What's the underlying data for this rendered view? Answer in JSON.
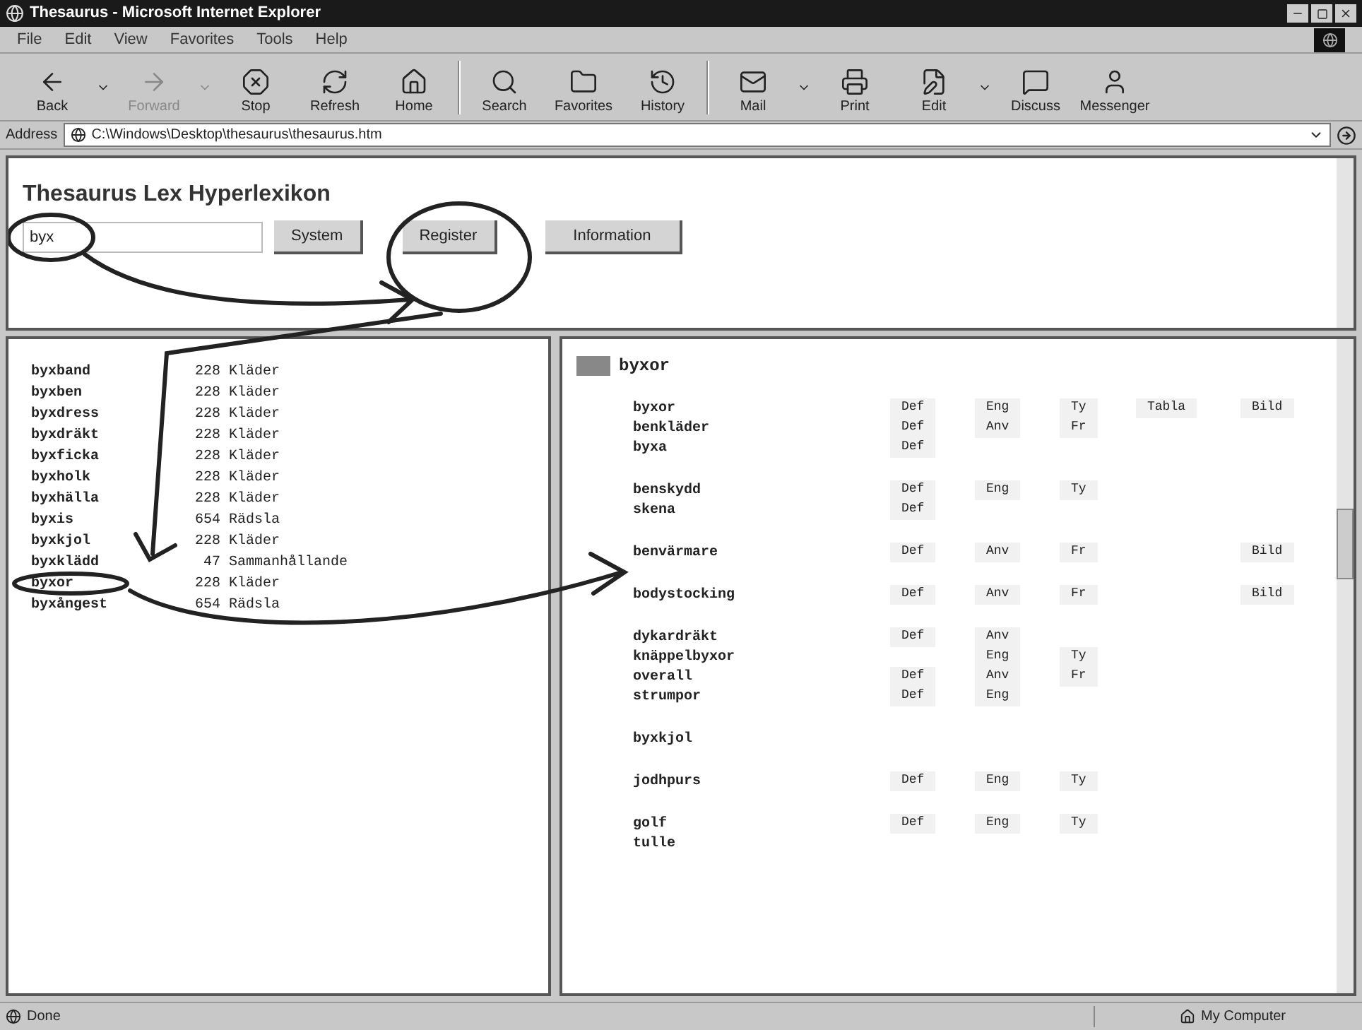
{
  "window": {
    "title": "Thesaurus - Microsoft Internet Explorer"
  },
  "menu": [
    "File",
    "Edit",
    "View",
    "Favorites",
    "Tools",
    "Help"
  ],
  "toolbar": [
    {
      "label": "Back",
      "dropdown": true,
      "disabled": false
    },
    {
      "label": "Forward",
      "dropdown": true,
      "disabled": true
    },
    {
      "label": "Stop",
      "dropdown": false,
      "disabled": false
    },
    {
      "label": "Refresh",
      "dropdown": false,
      "disabled": false
    },
    {
      "label": "Home",
      "dropdown": false,
      "disabled": false
    },
    {
      "label": "Search",
      "dropdown": false,
      "disabled": false
    },
    {
      "label": "Favorites",
      "dropdown": false,
      "disabled": false
    },
    {
      "label": "History",
      "dropdown": false,
      "disabled": false
    },
    {
      "label": "Mail",
      "dropdown": true,
      "disabled": false
    },
    {
      "label": "Print",
      "dropdown": false,
      "disabled": false
    },
    {
      "label": "Edit",
      "dropdown": true,
      "disabled": false
    },
    {
      "label": "Discuss",
      "dropdown": false,
      "disabled": false
    },
    {
      "label": "Messenger",
      "dropdown": false,
      "disabled": false
    }
  ],
  "address": {
    "label": "Address",
    "value": "C:\\Windows\\Desktop\\thesaurus\\thesaurus.htm"
  },
  "page": {
    "title": "Thesaurus Lex Hyperlexikon",
    "search": {
      "value": "byx"
    },
    "buttons": [
      "System",
      "Register",
      "Information"
    ]
  },
  "list": [
    {
      "word": "byxband",
      "number": "228",
      "category": "Kläder"
    },
    {
      "word": "byxben",
      "number": "228",
      "category": "Kläder"
    },
    {
      "word": "byxdress",
      "number": "228",
      "category": "Kläder"
    },
    {
      "word": "byxdräkt",
      "number": "228",
      "category": "Kläder"
    },
    {
      "word": "byxficka",
      "number": "228",
      "category": "Kläder"
    },
    {
      "word": "byxholk",
      "number": "228",
      "category": "Kläder"
    },
    {
      "word": "byxhälla",
      "number": "228",
      "category": "Kläder"
    },
    {
      "word": "byxis",
      "number": "654",
      "category": "Rädsla"
    },
    {
      "word": "byxkjol",
      "number": "228",
      "category": "Kläder"
    },
    {
      "word": "byxklädd",
      "number": "47",
      "category": "Sammanhållande"
    },
    {
      "word": "byxor",
      "number": "228",
      "category": "Kläder"
    },
    {
      "word": "byxångest",
      "number": "654",
      "category": "Rädsla"
    }
  ],
  "entry": {
    "heading": "byxor",
    "groups": [
      [
        {
          "word": "byxor",
          "links": [
            {
              "kind": "def",
              "text": "Def"
            },
            {
              "kind": "eng",
              "text": "Eng"
            },
            {
              "kind": "ty",
              "text": "Ty"
            },
            {
              "kind": "tabla",
              "text": "Tabla"
            },
            {
              "kind": "bild",
              "text": "Bild"
            }
          ]
        },
        {
          "word": "benkläder",
          "links": [
            {
              "kind": "def",
              "text": "Def"
            },
            {
              "kind": "eng",
              "text": "Anv"
            },
            {
              "kind": "ty",
              "text": "Fr"
            }
          ]
        },
        {
          "word": "byxa",
          "links": [
            {
              "kind": "def",
              "text": "Def"
            }
          ]
        }
      ],
      [
        {
          "word": "benskydd",
          "links": [
            {
              "kind": "def",
              "text": "Def"
            },
            {
              "kind": "eng",
              "text": "Eng"
            },
            {
              "kind": "ty",
              "text": "Ty"
            }
          ]
        },
        {
          "word": "skena",
          "links": [
            {
              "kind": "def",
              "text": "Def"
            }
          ]
        }
      ],
      [
        {
          "word": "benvärmare",
          "links": [
            {
              "kind": "def",
              "text": "Def"
            },
            {
              "kind": "eng",
              "text": "Anv"
            },
            {
              "kind": "ty",
              "text": "Fr"
            },
            {
              "kind": "bild",
              "text": "Bild"
            }
          ]
        }
      ],
      [
        {
          "word": "bodystocking",
          "links": [
            {
              "kind": "def",
              "text": "Def"
            },
            {
              "kind": "eng",
              "text": "Anv"
            },
            {
              "kind": "ty",
              "text": "Fr"
            },
            {
              "kind": "bild",
              "text": "Bild"
            }
          ]
        }
      ],
      [
        {
          "word": "dykardräkt",
          "links": [
            {
              "kind": "def",
              "text": "Def"
            },
            {
              "kind": "eng",
              "text": "Anv"
            }
          ]
        },
        {
          "word": "knäppelbyxor",
          "links": [
            {
              "kind": "eng",
              "text": "Eng"
            },
            {
              "kind": "ty",
              "text": "Ty"
            }
          ]
        },
        {
          "word": "overall",
          "links": [
            {
              "kind": "def",
              "text": "Def"
            },
            {
              "kind": "eng",
              "text": "Anv"
            },
            {
              "kind": "ty",
              "text": "Fr"
            }
          ]
        },
        {
          "word": "strumpor",
          "links": [
            {
              "kind": "def",
              "text": "Def"
            },
            {
              "kind": "eng",
              "text": "Eng"
            }
          ]
        }
      ],
      [
        {
          "word": "byxkjol"
        }
      ],
      [
        {
          "word": "jodhpurs",
          "links": [
            {
              "kind": "def",
              "text": "Def"
            },
            {
              "kind": "eng",
              "text": "Eng"
            },
            {
              "kind": "ty",
              "text": "Ty"
            }
          ]
        }
      ],
      [
        {
          "word": "golf",
          "links": [
            {
              "kind": "def",
              "text": "Def"
            },
            {
              "kind": "eng",
              "text": "Eng"
            },
            {
              "kind": "ty",
              "text": "Ty"
            }
          ]
        },
        {
          "word": "tulle"
        }
      ]
    ]
  },
  "status": {
    "text": "Done",
    "zone": "My Computer"
  }
}
